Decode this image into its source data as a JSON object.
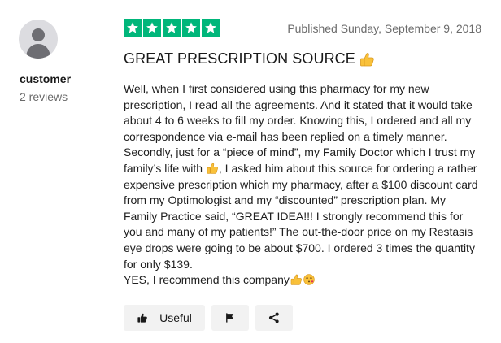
{
  "reviewer": {
    "name": "customer",
    "reviews_count": "2 reviews",
    "avatar_icon": "person-silhouette-icon"
  },
  "review": {
    "rating": 5,
    "rating_max": 5,
    "star_color": "#00b67a",
    "published": "Published Sunday, September 9, 2018",
    "title": "GREAT PRESCRIPTION SOURCE",
    "title_emoji": "thumbs-up-icon",
    "body_part1": "Well, when I first considered using this pharmacy for my new prescription, I read all the agreements. And it stated that it would take about 4 to 6 weeks to fill my order. Knowing this, I ordered and all my correspondence via e-mail has been replied on a timely manner. Secondly, just for a “piece of mind”, my Family Doctor which I trust my family’s life with ",
    "body_part2": ", I asked him about this source for ordering a rather expensive prescription which my pharmacy, after a $100 discount card from my Optimologist and my “discounted” prescription plan. My Family Practice said, “GREAT IDEA!!! I strongly recommend this for you and many of my patients!” The out-the-door price on my Restasis eye drops were going to be about $700. I ordered 3 times the quantity for only $139.",
    "closing": "YES, I recommend this company"
  },
  "actions": {
    "useful_label": "Useful",
    "useful_icon": "thumbs-up-icon",
    "flag_icon": "flag-icon",
    "share_icon": "share-icon"
  }
}
